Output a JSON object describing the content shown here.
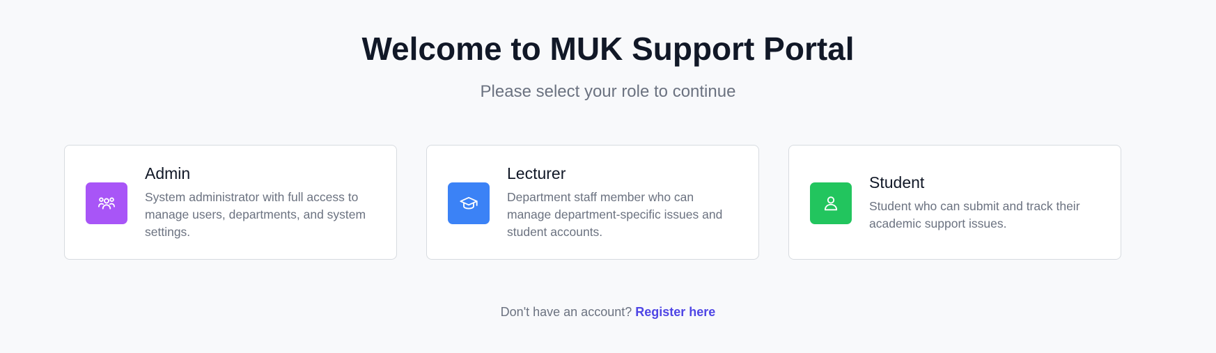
{
  "header": {
    "title": "Welcome to MUK Support Portal",
    "subtitle": "Please select your role to continue"
  },
  "roles": [
    {
      "title": "Admin",
      "description": "System administrator with full access to manage users, departments, and system settings.",
      "icon": "users-icon",
      "color": "#a855f7"
    },
    {
      "title": "Lecturer",
      "description": "Department staff member who can manage department-specific issues and student accounts.",
      "icon": "graduation-cap-icon",
      "color": "#3b82f6"
    },
    {
      "title": "Student",
      "description": "Student who can submit and track their academic support issues.",
      "icon": "user-icon",
      "color": "#22c55e"
    }
  ],
  "footer": {
    "prompt": "Don't have an account?",
    "link_label": "Register here",
    "link_color": "#4f46e5"
  }
}
